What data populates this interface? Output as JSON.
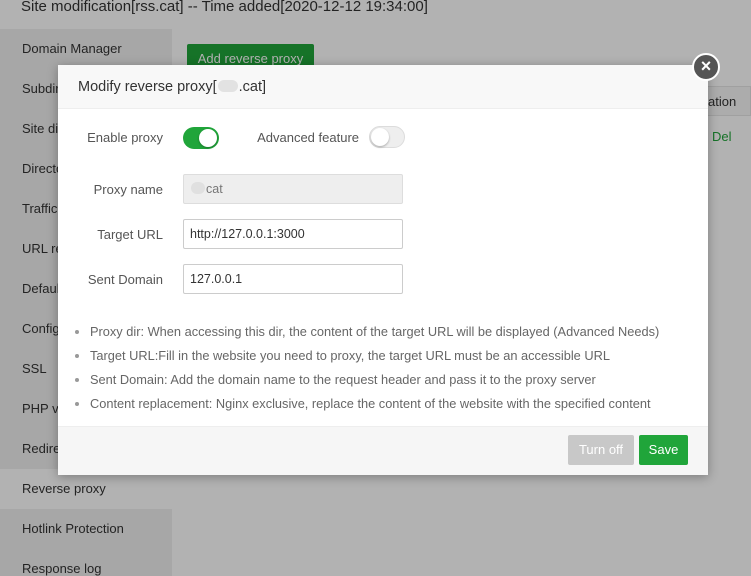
{
  "background": {
    "title": "Site modification[rss.cat] -- Time added[2020-12-12 19:34:00]",
    "sidebar": [
      {
        "label": "Domain Manager"
      },
      {
        "label": "Subdir"
      },
      {
        "label": "Site di"
      },
      {
        "label": "Directo"
      },
      {
        "label": "Traffic"
      },
      {
        "label": "URL re"
      },
      {
        "label": "Defaul"
      },
      {
        "label": "Config"
      },
      {
        "label": "SSL"
      },
      {
        "label": "PHP ve"
      },
      {
        "label": "Redire"
      },
      {
        "label": "Reverse proxy"
      },
      {
        "label": "Hotlink Protection"
      },
      {
        "label": "Response log"
      }
    ],
    "add_button": "Add reverse proxy",
    "table_header_partial": "ation",
    "row_action_partial": "Del"
  },
  "dialog": {
    "title_prefix": "Modify reverse proxy[",
    "title_suffix": ".cat]",
    "close_symbol": "×",
    "enable_proxy_label": "Enable proxy",
    "enable_proxy_on": true,
    "advanced_label": "Advanced feature",
    "advanced_on": false,
    "proxy_name_label": "Proxy name",
    "proxy_name_value": "cat",
    "target_url_label": "Target URL",
    "target_url_value": "http://127.0.0.1:3000",
    "sent_domain_label": "Sent Domain",
    "sent_domain_value": "127.0.0.1",
    "tips": [
      "Proxy dir: When accessing this dir, the content of the target URL will be displayed (Advanced Needs)",
      "Target URL:Fill in the website you need to proxy, the target URL must be an accessible URL",
      "Sent Domain: Add the domain name to the request header and pass it to the proxy server",
      "Content replacement: Nginx exclusive, replace the content of the website with the specified content"
    ],
    "turn_off_label": "Turn off",
    "save_label": "Save"
  },
  "colors": {
    "accent": "#20a53a",
    "disabled_button": "#c8c8c8"
  }
}
